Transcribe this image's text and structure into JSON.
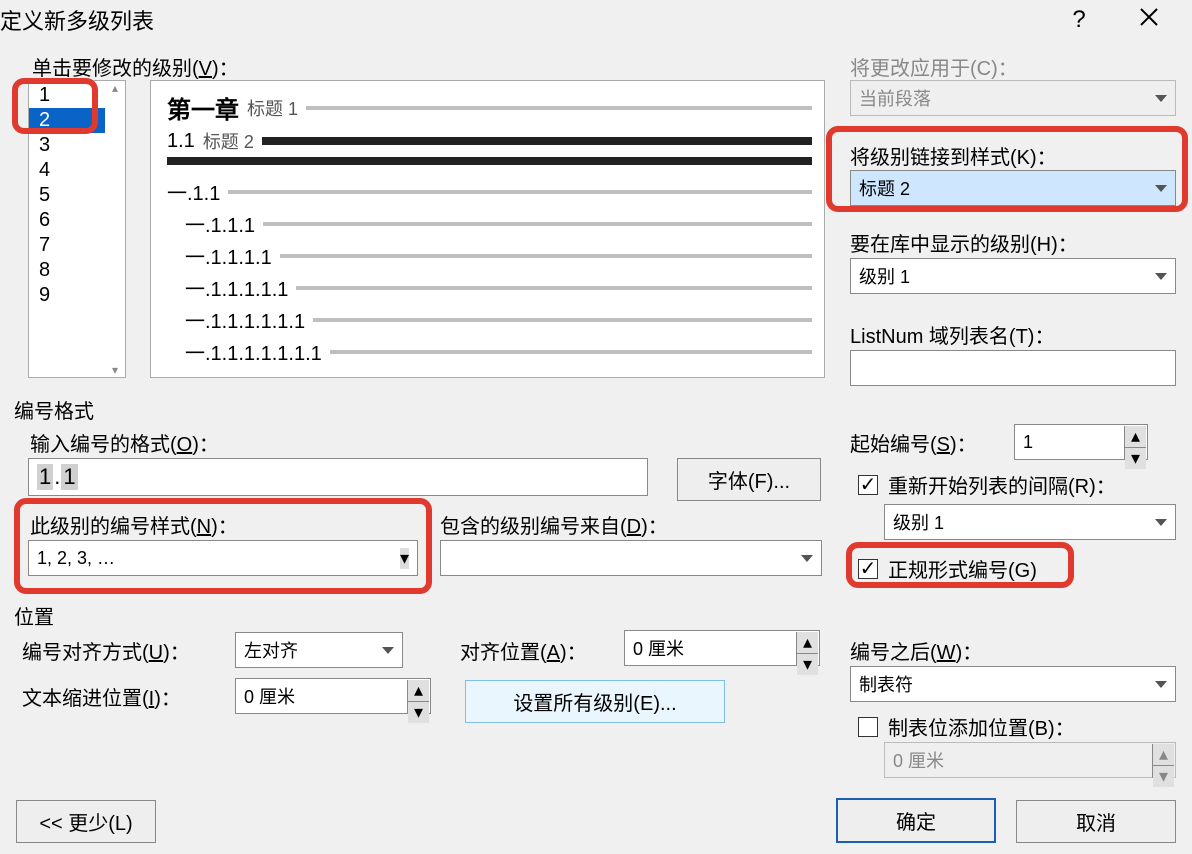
{
  "title": "定义新多级列表",
  "help": "?",
  "level_label": {
    "pre": "单击要修改的级别(",
    "key": "V",
    "post": ")："
  },
  "levels": [
    "1",
    "2",
    "3",
    "4",
    "5",
    "6",
    "7",
    "8",
    "9"
  ],
  "selected_level": 1,
  "preview": {
    "row1": "第一章",
    "row1sub": "标题 1",
    "row2": "1.1",
    "row2sub": "标题 2",
    "row3": "一.1.1",
    "row4": "一.1.1.1",
    "row5": "一.1.1.1.1",
    "row6": "一.1.1.1.1.1",
    "row7": "一.1.1.1.1.1.1",
    "row8": "一.1.1.1.1.1.1.1",
    "row9": "一.1.1.1.1.1.1.1.1"
  },
  "apply_to_label": {
    "pre": "将更改应用于(",
    "key": "C",
    "post": ")："
  },
  "apply_to_value": "当前段落",
  "link_style_label": {
    "pre": "将级别链接到样式(",
    "key": "K",
    "post": ")："
  },
  "link_style_value": "标题 2",
  "show_in_gallery_label": {
    "pre": "要在库中显示的级别(",
    "key": "H",
    "post": ")："
  },
  "show_in_gallery_value": "级别 1",
  "listnum_label": {
    "pre": "ListNum 域列表名(",
    "key": "T",
    "post": ")："
  },
  "listnum_value": "",
  "section_format": "编号格式",
  "number_format_label": {
    "pre": "输入编号的格式(",
    "key": "O",
    "post": ")："
  },
  "number_format_value": "1.1",
  "font_btn": {
    "pre": "字体(",
    "key": "F",
    "post": ")..."
  },
  "number_style_label": {
    "pre": "此级别的编号样式(",
    "key": "N",
    "post": ")："
  },
  "number_style_value": "1, 2, 3, …",
  "include_from_label": {
    "pre": "包含的级别编号来自(",
    "key": "D",
    "post": ")："
  },
  "include_from_value": "",
  "start_at_label": {
    "pre": "起始编号(",
    "key": "S",
    "post": ")："
  },
  "start_at_value": "1",
  "restart_label": {
    "pre": "重新开始列表的间隔(",
    "key": "R",
    "post": ")："
  },
  "restart_value": "级别 1",
  "legal_label": {
    "pre": "正规形式编号(",
    "key": "G",
    "post": ")"
  },
  "section_position": "位置",
  "align_label": {
    "pre": "编号对齐方式(",
    "key": "U",
    "post": ")："
  },
  "align_value": "左对齐",
  "align_at_label": {
    "pre": "对齐位置(",
    "key": "A",
    "post": ")："
  },
  "align_at_value": "0 厘米",
  "indent_at_label": {
    "pre": "文本缩进位置(",
    "key": "I",
    "post": ")："
  },
  "indent_at_value": "0 厘米",
  "set_all_btn": {
    "pre": "设置所有级别(",
    "key": "E",
    "post": ")..."
  },
  "follow_label": {
    "pre": "编号之后(",
    "key": "W",
    "post": ")："
  },
  "follow_value": "制表符",
  "tab_stop_label": {
    "pre": "制表位添加位置(",
    "key": "B",
    "post": ")："
  },
  "tab_stop_value": "0 厘米",
  "less_btn": {
    "pre": "<< 更少(",
    "key": "L",
    "post": ")"
  },
  "ok_btn": "确定",
  "cancel_btn": "取消"
}
